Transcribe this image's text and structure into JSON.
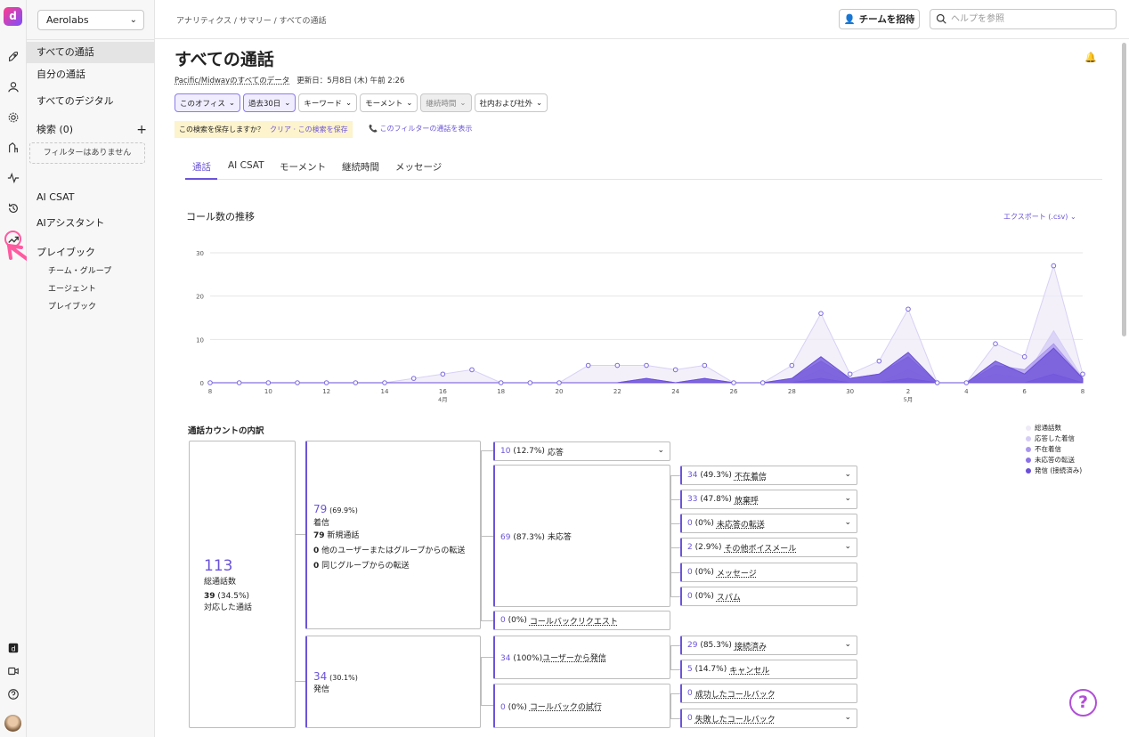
{
  "rail": {
    "logo": "d",
    "icons": [
      "rocket-icon",
      "user-icon",
      "gear-icon",
      "route-icon",
      "activity-icon",
      "history-icon",
      "trending-icon"
    ],
    "bottom_icons": [
      "dialpad-icon",
      "video-icon",
      "help-circle-icon",
      "avatar"
    ]
  },
  "sidebar": {
    "org": "Aerolabs",
    "items": {
      "all_calls": "すべての通話",
      "my_calls": "自分の通話",
      "all_digital": "すべてのデジタル",
      "search": "検索 (0)",
      "no_filter": "フィルターはありません",
      "ai_csat": "AI CSAT",
      "ai_assistant": "AIアシスタント",
      "playbook": "プレイブック",
      "team_group": "チーム・グループ",
      "agent": "エージェント",
      "playbook_sub": "プレイブック"
    }
  },
  "topbar": {
    "breadcrumb": "アナリティクス / サマリー / すべての通話",
    "invite": "チームを招待",
    "search_placeholder": "ヘルプを参照"
  },
  "page": {
    "title": "すべての通話",
    "data_link": "Pacific/Midwayのすべてのデータ",
    "updated": "更新日：5月8日 (木) 午前 2:26",
    "filters": [
      "このオフィス",
      "過去30日",
      "キーワード",
      "モーメント",
      "継続時間",
      "社内および社外"
    ],
    "save_prompt": "この検索を保存しますか？",
    "save_actions": "クリア · この検索を保存",
    "show_calls": "このフィルターの通話を表示",
    "tabs": [
      "通話",
      "AI CSAT",
      "モーメント",
      "継続時間",
      "メッセージ"
    ],
    "chart_title": "コール数の推移",
    "export": "エクスポート (.csv)",
    "breakdown_title": "通話カウントの内訳"
  },
  "chart_data": {
    "type": "area",
    "x_ticks": [
      "8",
      "10",
      "12",
      "14",
      "16",
      "18",
      "20",
      "22",
      "24",
      "26",
      "28",
      "30",
      "2",
      "4",
      "6",
      "8"
    ],
    "month_labels": [
      "4月",
      "5月"
    ],
    "ylim": [
      0,
      30
    ],
    "y_ticks": [
      "0",
      "10",
      "20",
      "30"
    ],
    "x": [
      8,
      9,
      10,
      11,
      12,
      13,
      14,
      15,
      16,
      17,
      18,
      19,
      20,
      21,
      22,
      23,
      24,
      25,
      26,
      27,
      28,
      29,
      30,
      1,
      2,
      3,
      4,
      5,
      6,
      7,
      8
    ],
    "series": [
      {
        "name": "総通話数",
        "color": "#eeeaf8",
        "values": [
          0,
          0,
          0,
          0,
          0,
          0,
          0,
          1,
          2,
          3,
          0,
          0,
          0,
          4,
          4,
          4,
          3,
          4,
          0,
          0,
          4,
          16,
          2,
          5,
          17,
          0,
          0,
          9,
          6,
          27,
          2
        ]
      },
      {
        "name": "応答した着信",
        "color": "#d5ccf5",
        "values": [
          0,
          0,
          0,
          0,
          0,
          0,
          0,
          0,
          0,
          0,
          0,
          0,
          0,
          0,
          0,
          0,
          0,
          0,
          0,
          0,
          0,
          3,
          0,
          0,
          3,
          0,
          0,
          2,
          1,
          12,
          1
        ]
      },
      {
        "name": "不在着信",
        "color": "#a996ee",
        "values": [
          0,
          0,
          0,
          0,
          0,
          0,
          0,
          0,
          0,
          0,
          0,
          0,
          0,
          0,
          0,
          1,
          0,
          1,
          0,
          0,
          1,
          5,
          1,
          2,
          6,
          0,
          0,
          4,
          3,
          9,
          1
        ]
      },
      {
        "name": "未応答の転送",
        "color": "#8b72e6",
        "values": [
          0,
          0,
          0,
          0,
          0,
          0,
          0,
          0,
          0,
          0,
          0,
          0,
          0,
          0,
          0,
          0,
          0,
          0,
          0,
          0,
          0,
          1,
          0,
          0,
          1,
          0,
          0,
          0,
          0,
          2,
          0
        ]
      },
      {
        "name": "発信 (接続済み)",
        "color": "#6b4fd8",
        "values": [
          0,
          0,
          0,
          0,
          0,
          0,
          0,
          0,
          0,
          0,
          0,
          0,
          0,
          0,
          0,
          1,
          0,
          1,
          0,
          0,
          1,
          6,
          1,
          2,
          7,
          0,
          0,
          5,
          2,
          8,
          1
        ]
      }
    ]
  },
  "breakdown": {
    "total": {
      "value": "113",
      "label": "総通話数",
      "handled_num": "39",
      "handled_pct": "(34.5%)",
      "handled_label": "対応した通話"
    },
    "incoming": {
      "value": "79",
      "pct": "(69.9%)",
      "label": "着信",
      "lines": [
        [
          "79",
          "新規通話"
        ],
        [
          "0",
          "他のユーザーまたはグループからの転送"
        ],
        [
          "0",
          "同じグループからの転送"
        ]
      ]
    },
    "outgoing": {
      "value": "34",
      "pct": "(30.1%)",
      "label": "発信"
    },
    "answered": {
      "num": "10",
      "rest": "(12.7%)",
      "label": "応答"
    },
    "unanswered": {
      "num": "69",
      "rest": "(87.3%)",
      "label": "未応答"
    },
    "callback_request": {
      "num": "0",
      "rest": "(0%)",
      "label": "コールバックリクエスト"
    },
    "unanswered_items": [
      {
        "num": "34",
        "rest": "(49.3%)",
        "label": "不在着信",
        "dd": true
      },
      {
        "num": "33",
        "rest": "(47.8%)",
        "label": "放棄呼",
        "dd": true
      },
      {
        "num": "0",
        "rest": "(0%)",
        "label": "未応答の転送",
        "dd": true
      },
      {
        "num": "2",
        "rest": "(2.9%)",
        "label": "その他ボイスメール",
        "dd": true
      },
      {
        "num": "0",
        "rest": "(0%)",
        "label": "メッセージ",
        "dd": false
      },
      {
        "num": "0",
        "rest": "(0%)",
        "label": "スパム",
        "dd": false
      }
    ],
    "user_outgoing": {
      "num": "34",
      "rest": "(100%)",
      "label": "ユーザーから発信"
    },
    "callback_attempt": {
      "num": "0",
      "rest": "(0%)",
      "label": "コールバックの試行"
    },
    "outgoing_items": [
      {
        "num": "29",
        "rest": "(85.3%)",
        "label": "接続済み",
        "dd": true
      },
      {
        "num": "5",
        "rest": "(14.7%)",
        "label": "キャンセル",
        "dd": false
      }
    ],
    "callback_items": [
      {
        "num": "0",
        "rest": "",
        "label": "成功したコールバック",
        "dd": false
      },
      {
        "num": "0",
        "rest": "",
        "label": "失敗したコールバック",
        "dd": true
      }
    ]
  },
  "help_button": "?"
}
